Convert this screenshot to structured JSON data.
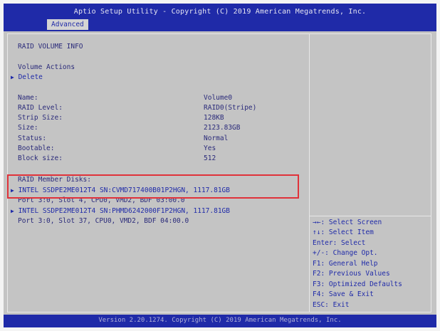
{
  "header": {
    "title": "Aptio Setup Utility - Copyright (C) 2019 American Megatrends, Inc.",
    "tab": "Advanced"
  },
  "main": {
    "section_title": "RAID VOLUME INFO",
    "actions_title": "Volume Actions",
    "delete_label": "Delete",
    "fields": [
      {
        "label": "Name:",
        "value": "Volume0"
      },
      {
        "label": "RAID Level:",
        "value": "RAID0(Stripe)"
      },
      {
        "label": "Strip Size:",
        "value": "128KB"
      },
      {
        "label": "Size:",
        "value": "2123.83GB"
      },
      {
        "label": "Status:",
        "value": "Normal"
      },
      {
        "label": "Bootable:",
        "value": "Yes"
      },
      {
        "label": "Block size:",
        "value": "512"
      }
    ],
    "member_disks_title": "RAID Member Disks:",
    "disks": [
      {
        "name": "INTEL SSDPE2ME012T4 SN:CVMD717400B01P2HGN, 1117.81GB",
        "port": "Port 3:0, Slot  4, CPU0, VMD2, BDF 03:00.0"
      },
      {
        "name": "INTEL SSDPE2ME012T4 SN:PHMD6242000F1P2HGN, 1117.81GB",
        "port": "Port 3:0, Slot 37, CPU0, VMD2, BDF 04:00.0"
      }
    ]
  },
  "help": {
    "items": [
      "→←: Select Screen",
      "↑↓: Select Item",
      "Enter: Select",
      "+/-: Change Opt.",
      "F1: General Help",
      "F2: Previous Values",
      "F3: Optimized Defaults",
      "F4: Save & Exit",
      "ESC: Exit"
    ]
  },
  "footer": {
    "version": "Version 2.20.1274. Copyright (C) 2019 American Megatrends, Inc."
  },
  "colors": {
    "title_bar": "#1f2aa8",
    "panel": "#c4c4c4",
    "highlight_box": "#e0323a"
  }
}
